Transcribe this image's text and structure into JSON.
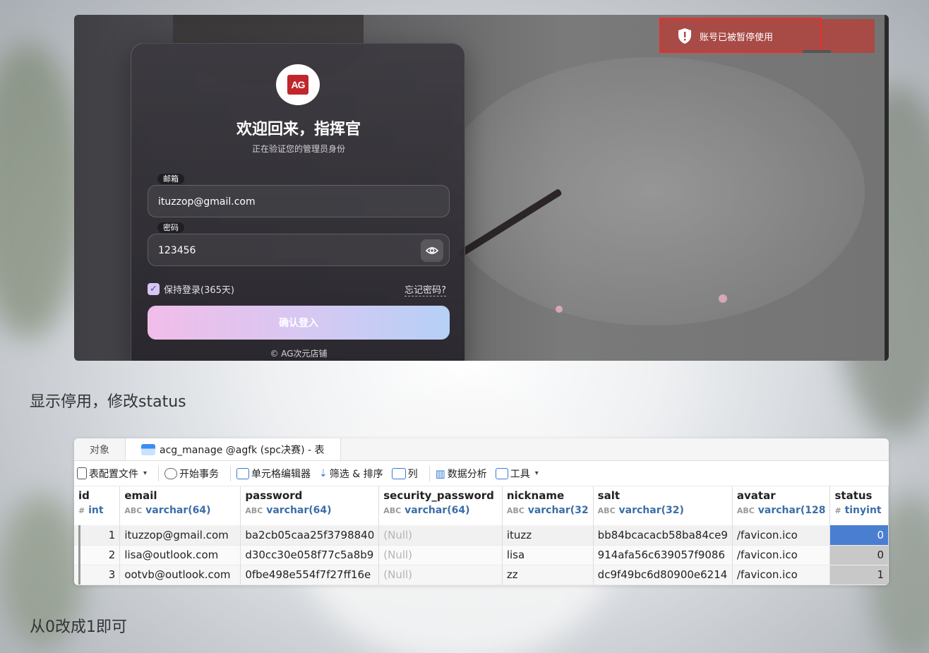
{
  "login_screen": {
    "logo_text": "AG",
    "title": "欢迎回来，指挥官",
    "subtitle": "正在验证您的管理员身份",
    "email_label": "邮箱",
    "email_value": "ituzzop@gmail.com",
    "password_label": "密码",
    "password_value": "123456",
    "remember_label": "保持登录(365天)",
    "forgot_label": "忘记密码?",
    "login_button": "确认登入",
    "copyright": "© AG次元店铺",
    "toast_message": "账号已被暂停使用",
    "colors": {
      "toast": "#a84a46",
      "button_start": "#f1bde9",
      "button_end": "#b6d0f6"
    }
  },
  "note1": "显示停用，修改status",
  "note2": "从0改成1即可",
  "db_tool": {
    "tabs": [
      "对象",
      "acg_manage @agfk (spc决赛) - 表"
    ],
    "toolbar": {
      "table_config": "表配置文件",
      "begin_transaction": "开始事务",
      "cell_editor": "单元格编辑器",
      "filter_sort": "筛选 & 排序",
      "columns": "列",
      "data_analysis": "数据分析",
      "tools": "工具"
    },
    "columns": [
      {
        "name": "id",
        "type": "int",
        "type_icon": "#"
      },
      {
        "name": "email",
        "type": "varchar(64)",
        "type_icon": "ABC"
      },
      {
        "name": "password",
        "type": "varchar(64)",
        "type_icon": "ABC"
      },
      {
        "name": "security_password",
        "type": "varchar(64)",
        "type_icon": "ABC"
      },
      {
        "name": "nickname",
        "type": "varchar(32",
        "type_icon": "ABC"
      },
      {
        "name": "salt",
        "type": "varchar(32)",
        "type_icon": "ABC"
      },
      {
        "name": "avatar",
        "type": "varchar(128",
        "type_icon": "ABC"
      },
      {
        "name": "status",
        "type": "tinyint",
        "type_icon": "#"
      }
    ],
    "rows": [
      [
        "1",
        "ituzzop@gmail.com",
        "ba2cb05caa25f3798840",
        "(Null)",
        "ituzz",
        "bb84bcacacb58ba84ce9",
        "/favicon.ico",
        "0"
      ],
      [
        "2",
        "lisa@outlook.com",
        "d30cc30e058f77c5a8b9",
        "(Null)",
        "lisa",
        "914afa56c639057f9086",
        "/favicon.ico",
        "0"
      ],
      [
        "3",
        "ootvb@outlook.com",
        "0fbe498e554f7f27ff16e",
        "(Null)",
        "zz",
        "dc9f49bc6d80900e6214",
        "/favicon.ico",
        "1"
      ]
    ]
  }
}
